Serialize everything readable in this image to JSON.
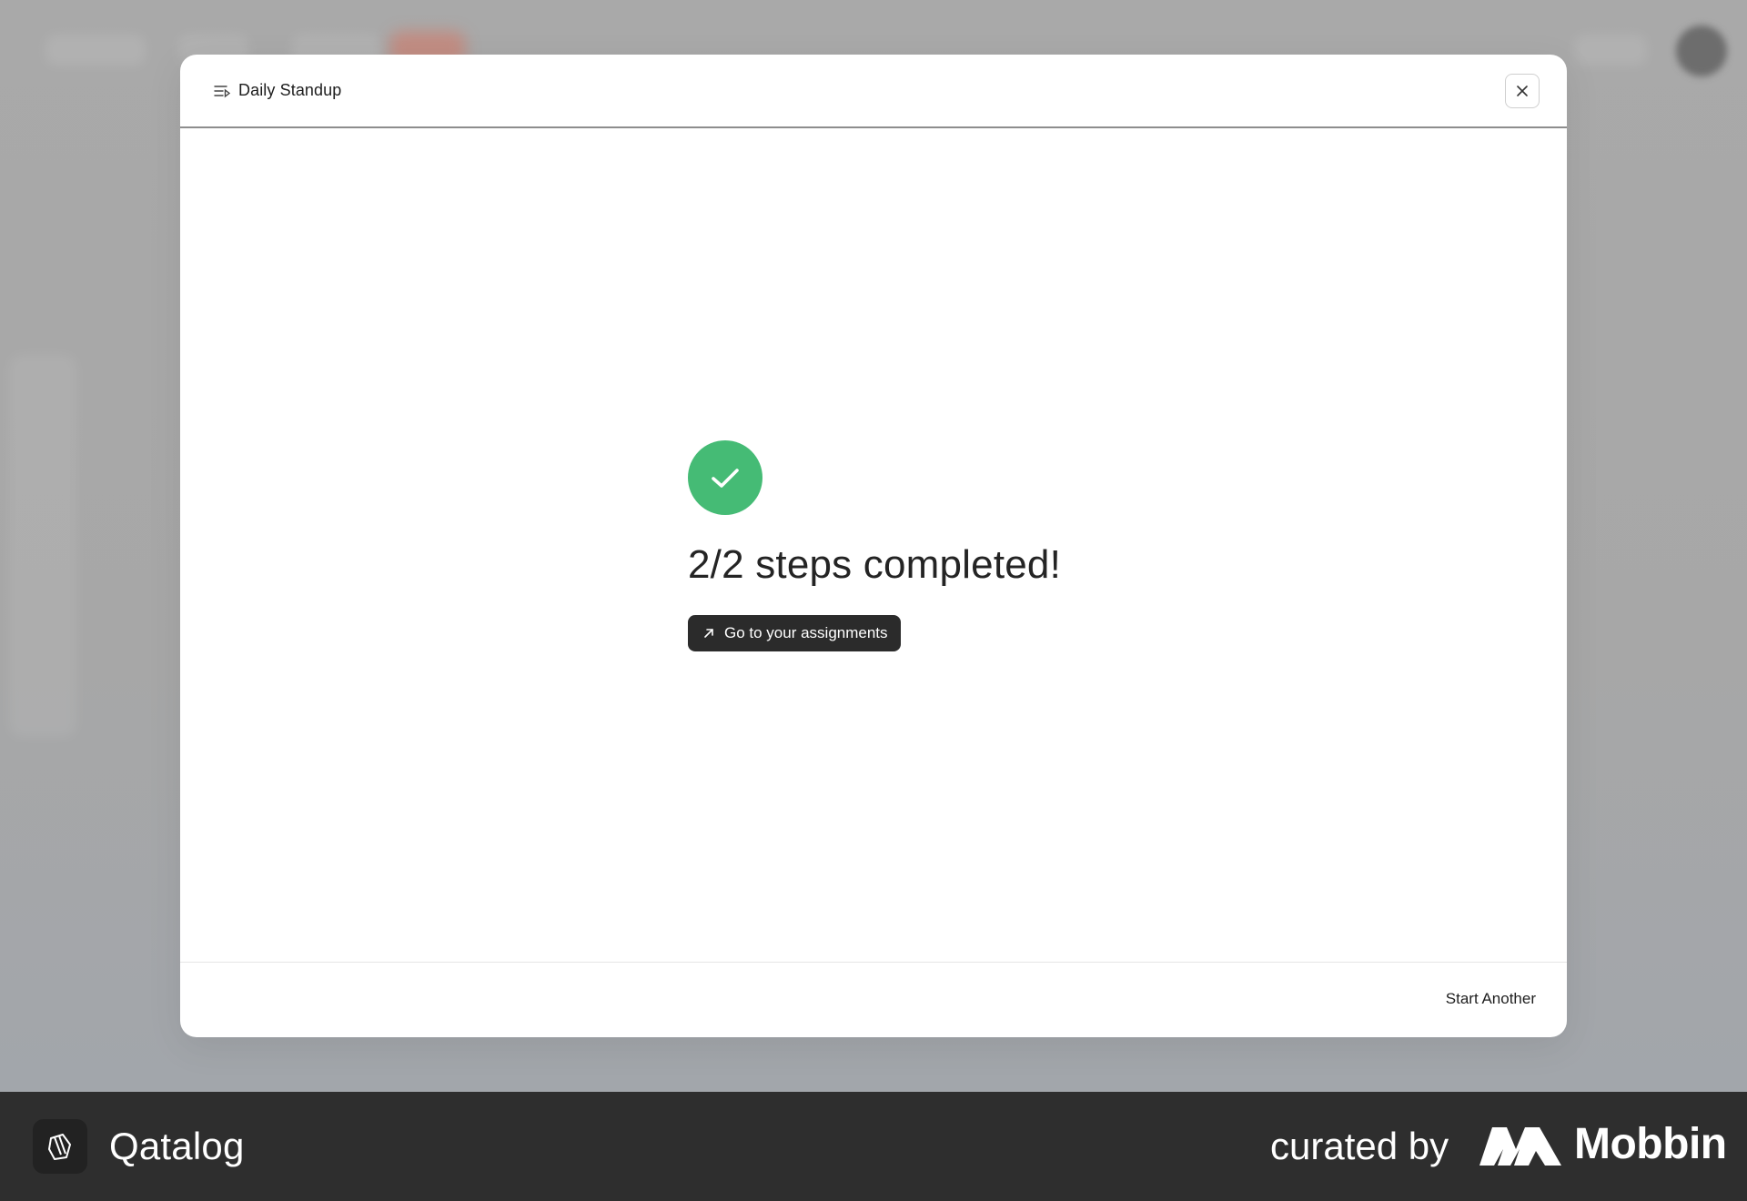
{
  "modal": {
    "title": "Daily Standup",
    "title_icon": "list-icon",
    "close_icon": "close-icon",
    "status_icon": "check-icon",
    "status_color": "#45bb75",
    "completion_text": "2/2 steps completed!",
    "primary_action": {
      "label": "Go to your assignments",
      "icon": "arrow-up-right-icon",
      "background": "#2b2b2b"
    },
    "footer_action": "Start Another"
  },
  "banner": {
    "brand": "Qatalog",
    "curated_by": "curated by",
    "mobbin": "Mobbin"
  }
}
